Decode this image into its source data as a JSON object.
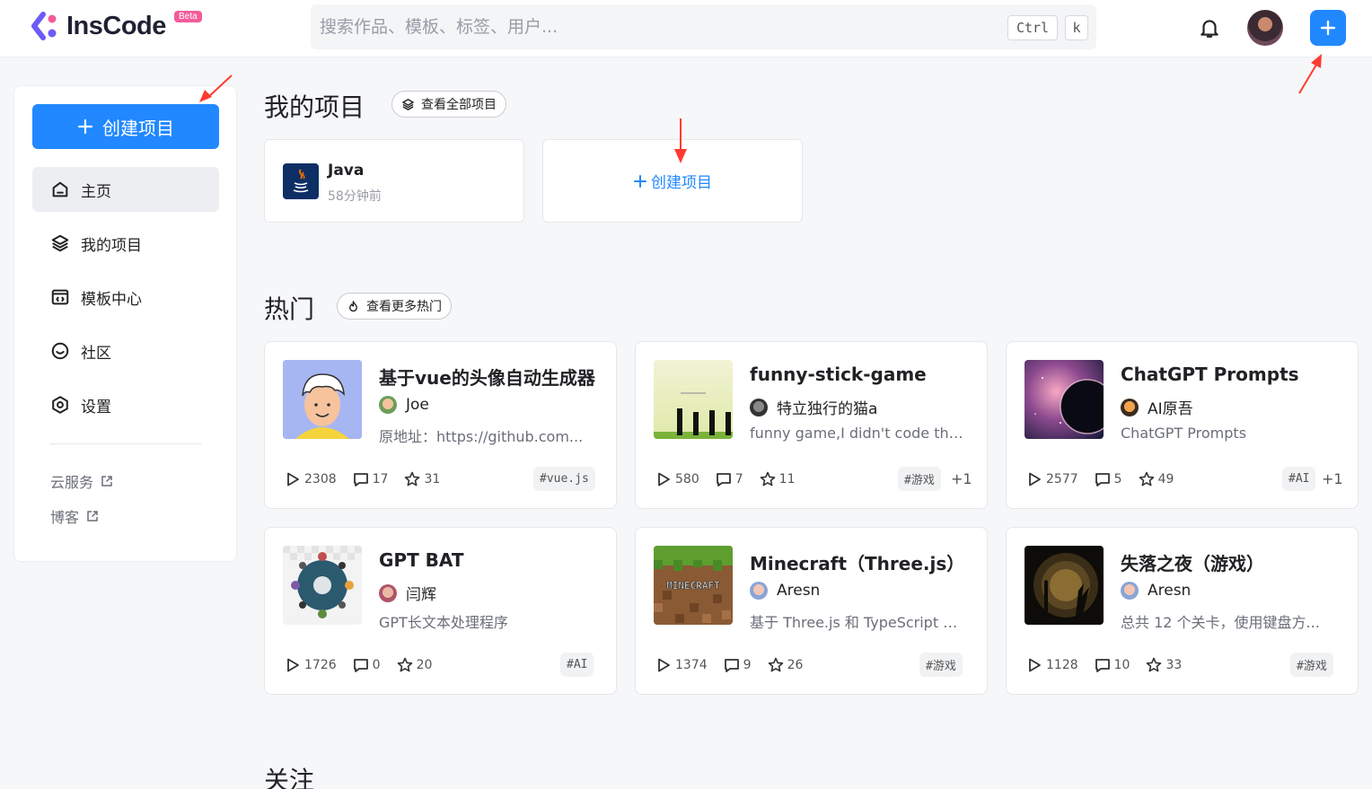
{
  "header": {
    "logo_text": "InsCode",
    "beta_label": "Beta",
    "search_placeholder": "搜索作品、模板、标签、用户...",
    "kbd_ctrl": "Ctrl",
    "kbd_k": "k"
  },
  "sidebar": {
    "create_label": "创建项目",
    "items": [
      {
        "label": "主页",
        "icon": "home-icon",
        "active": true
      },
      {
        "label": "我的项目",
        "icon": "layers-icon"
      },
      {
        "label": "模板中心",
        "icon": "template-icon"
      },
      {
        "label": "社区",
        "icon": "community-icon"
      },
      {
        "label": "设置",
        "icon": "settings-icon"
      }
    ],
    "links": [
      {
        "label": "云服务"
      },
      {
        "label": "博客"
      }
    ]
  },
  "my_projects": {
    "title": "我的项目",
    "view_all": "查看全部项目",
    "project": {
      "name": "Java",
      "time": "58分钟前"
    },
    "create_label": "创建项目"
  },
  "hot": {
    "title": "热门",
    "view_more": "查看更多热门",
    "cards": [
      {
        "title": "基于vue的头像自动生成器",
        "author": "Joe",
        "desc": "原地址：https://github.com...",
        "runs": "2308",
        "comments": "17",
        "stars": "31",
        "tag": "#vue.js",
        "more": ""
      },
      {
        "title": "funny-stick-game",
        "author": "特立独行的猫a",
        "desc": "funny game,I didn't code this...",
        "runs": "580",
        "comments": "7",
        "stars": "11",
        "tag": "#游戏",
        "more": "+1"
      },
      {
        "title": "ChatGPT Prompts",
        "author": "AI原吾",
        "desc": "ChatGPT Prompts",
        "runs": "2577",
        "comments": "5",
        "stars": "49",
        "tag": "#AI",
        "more": "+1"
      },
      {
        "title": "GPT BAT",
        "author": "闫辉",
        "desc": "GPT长文本处理程序",
        "runs": "1726",
        "comments": "0",
        "stars": "20",
        "tag": "#AI",
        "more": ""
      },
      {
        "title": "Minecraft（Three.js）",
        "author": "Aresn",
        "desc": "基于 Three.js 和 TypeScript 的...",
        "runs": "1374",
        "comments": "9",
        "stars": "26",
        "tag": "#游戏",
        "more": ""
      },
      {
        "title": "失落之夜（游戏）",
        "author": "Aresn",
        "desc": "总共 12 个关卡，使用键盘方...",
        "runs": "1128",
        "comments": "10",
        "stars": "33",
        "tag": "#游戏",
        "more": ""
      }
    ]
  },
  "follow": {
    "title": "关注"
  },
  "thumb_text": {
    "minecraft": "MINECRAFT"
  },
  "colors": {
    "accent": "#2188ff",
    "arrow": "#ff3b30"
  }
}
